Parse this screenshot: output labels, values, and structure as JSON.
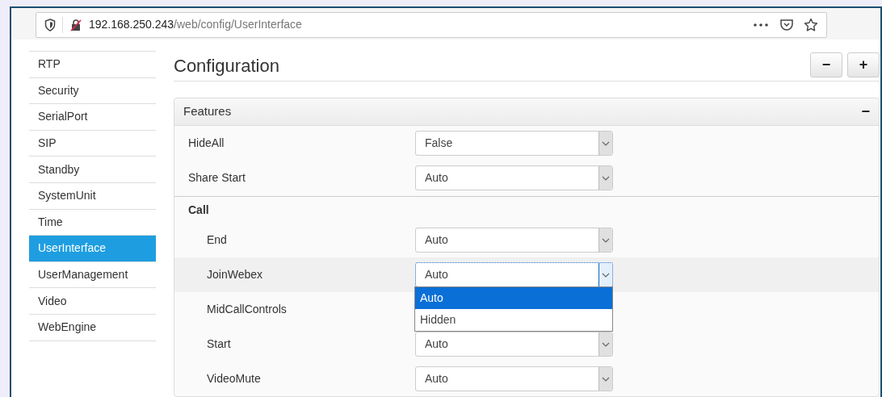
{
  "address_bar": {
    "host": "192.168.250.243",
    "path": "/web/config/UserInterface"
  },
  "sidebar": {
    "items": [
      {
        "label": "RTP",
        "selected": false
      },
      {
        "label": "Security",
        "selected": false
      },
      {
        "label": "SerialPort",
        "selected": false
      },
      {
        "label": "SIP",
        "selected": false
      },
      {
        "label": "Standby",
        "selected": false
      },
      {
        "label": "SystemUnit",
        "selected": false
      },
      {
        "label": "Time",
        "selected": false
      },
      {
        "label": "UserInterface",
        "selected": true
      },
      {
        "label": "UserManagement",
        "selected": false
      },
      {
        "label": "Video",
        "selected": false
      },
      {
        "label": "WebEngine",
        "selected": false
      }
    ]
  },
  "header": {
    "title": "Configuration",
    "buttons": [
      "−",
      "+"
    ]
  },
  "panel": {
    "title": "Features",
    "collapse": "−",
    "settings": [
      {
        "label": "HideAll",
        "value": "False",
        "focused": false
      },
      {
        "label": "Share Start",
        "value": "Auto",
        "focused": false
      },
      {
        "label": "Call",
        "children": [
          {
            "label": "End",
            "value": "Auto",
            "focused": false
          },
          {
            "label": "JoinWebex",
            "value": "Auto",
            "focused": true,
            "dropdown": [
              {
                "label": "Auto",
                "selected": true
              },
              {
                "label": "Hidden",
                "selected": false
              }
            ]
          },
          {
            "label": "MidCallControls"
          },
          {
            "label": "Start",
            "value": "Auto",
            "focused": false
          },
          {
            "label": "VideoMute",
            "value": "Auto",
            "focused": false
          }
        ]
      }
    ]
  }
}
